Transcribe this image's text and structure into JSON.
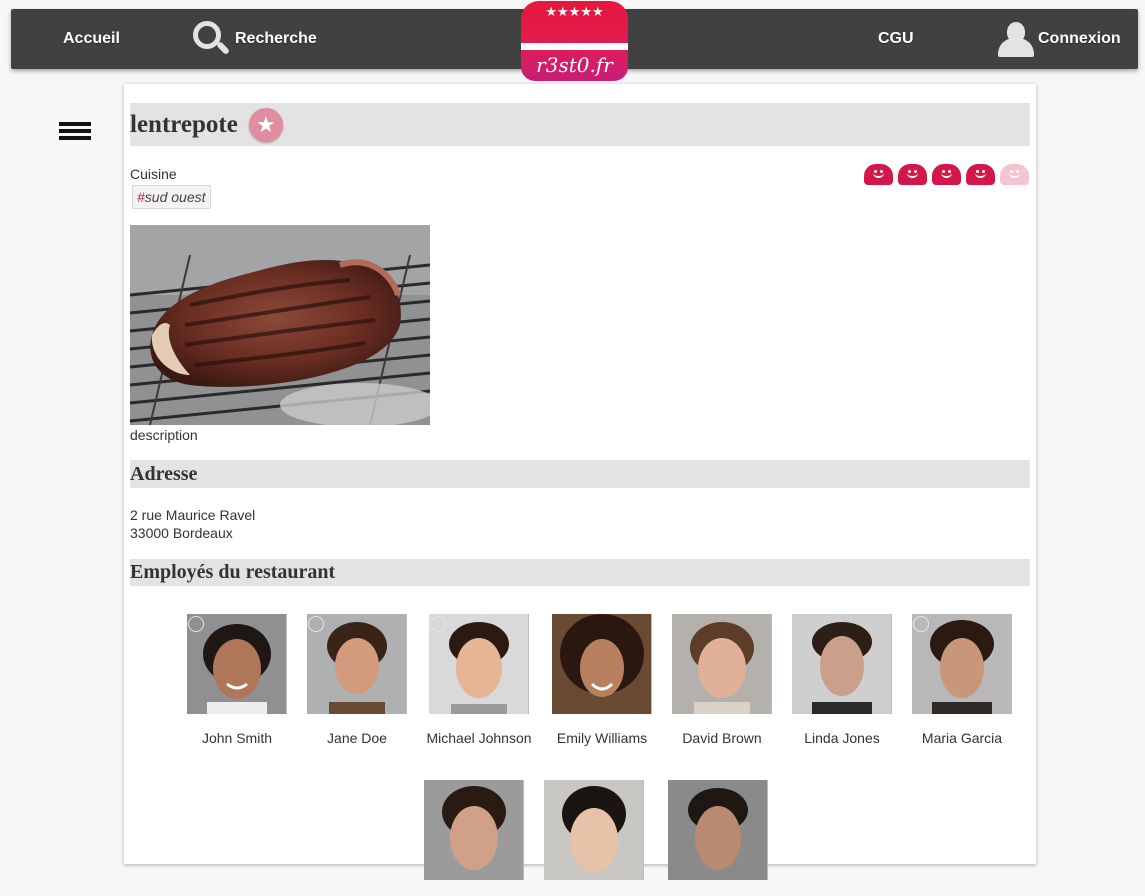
{
  "nav": {
    "home": "Accueil",
    "search": "Recherche",
    "terms": "CGU",
    "login": "Connexion"
  },
  "logo": {
    "stars": "★★★★★",
    "brand": "r3st0.fr"
  },
  "restaurant": {
    "name": "lentrepote",
    "cuisine_label": "Cuisine",
    "tags": [
      "sud ouest"
    ],
    "rating": 4,
    "rating_max": 5,
    "photo_alt": "grilled steak",
    "description": "description"
  },
  "address": {
    "heading": "Adresse",
    "line1": "2 rue Maurice Ravel",
    "line2": "33000 Bordeaux"
  },
  "staff": {
    "heading": "Employés du restaurant",
    "members": [
      {
        "name": "John Smith"
      },
      {
        "name": "Jane Doe"
      },
      {
        "name": "Michael Johnson"
      },
      {
        "name": "Emily Williams"
      },
      {
        "name": "David Brown"
      },
      {
        "name": "Linda Jones"
      },
      {
        "name": "Maria Garcia"
      },
      {
        "name": ""
      },
      {
        "name": ""
      },
      {
        "name": ""
      }
    ]
  },
  "colors": {
    "nav_bg": "#414141",
    "accent": "#d3174a",
    "section_bg": "#e3e3e3"
  }
}
